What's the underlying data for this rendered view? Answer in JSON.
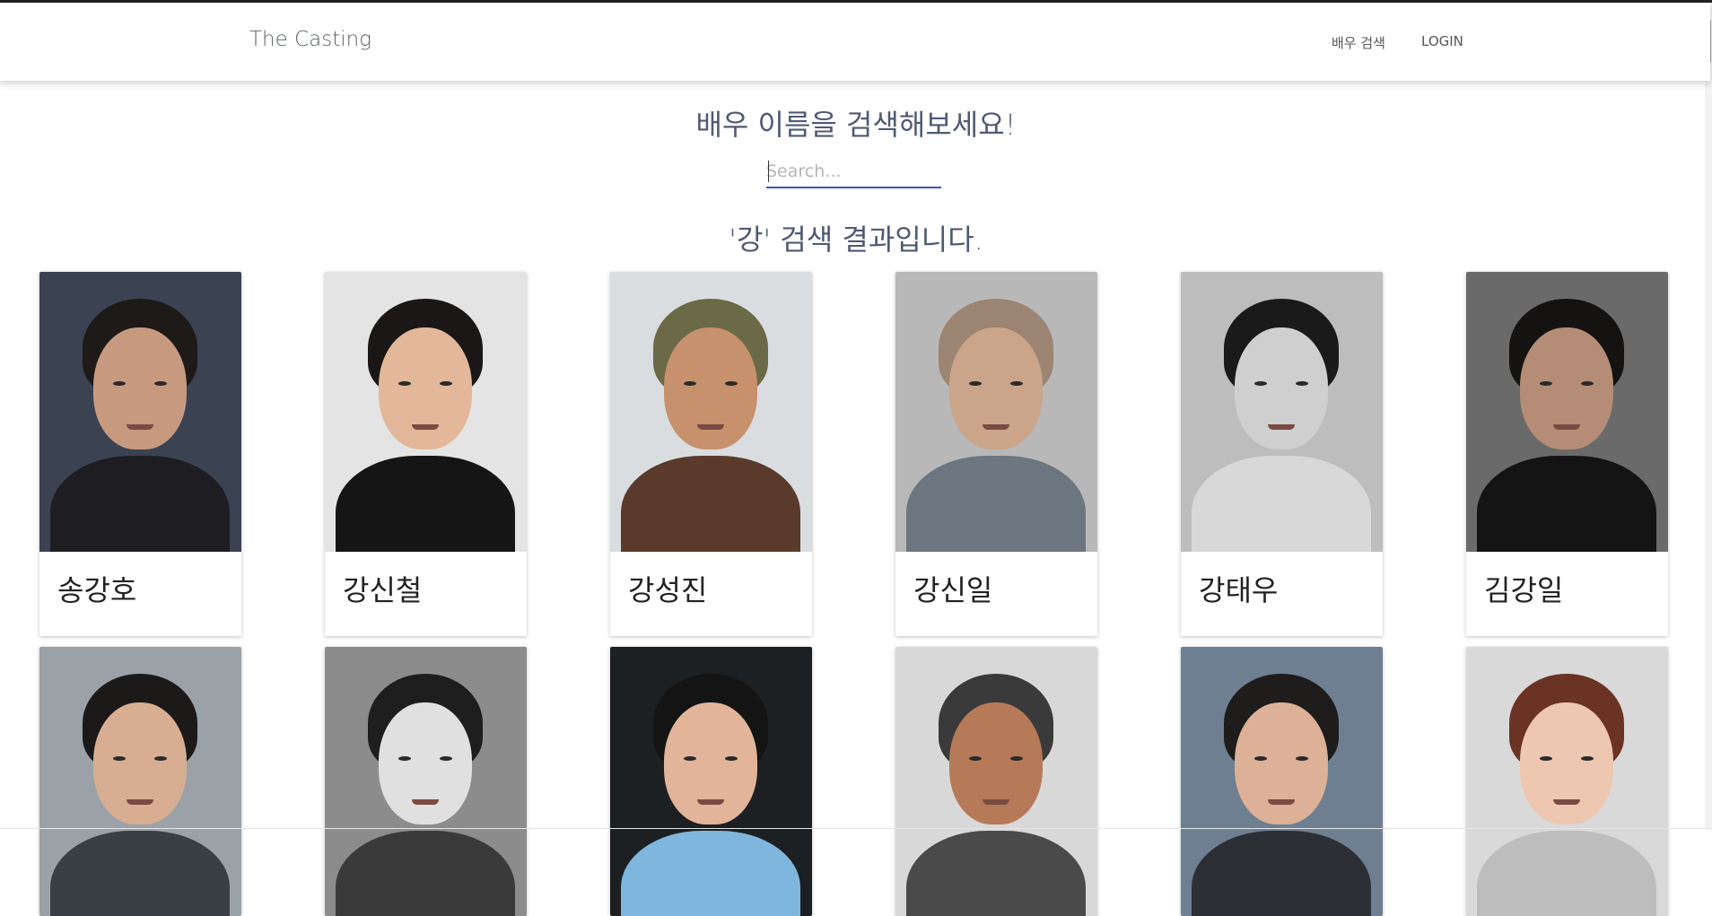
{
  "navbar": {
    "brand": "The Casting",
    "links": [
      {
        "label": "배우 검색"
      },
      {
        "label": "LOGIN"
      }
    ]
  },
  "search": {
    "heading": "배우 이름을 검색해보세요!",
    "placeholder": "Search...",
    "value": ""
  },
  "results": {
    "heading": "'강' 검색 결과입니다.",
    "actors": [
      {
        "name": "송강호",
        "photo_bg": "#3b4352",
        "skin": "#c79a80",
        "hair": "#1e1a18",
        "cloth": "#1e1e22"
      },
      {
        "name": "강신철",
        "photo_bg": "#e4e4e4",
        "skin": "#e3b799",
        "hair": "#1a1716",
        "cloth": "#151515"
      },
      {
        "name": "강성진",
        "photo_bg": "#d9dde0",
        "skin": "#c7916d",
        "hair": "#6b6a46",
        "cloth": "#5a3a2a"
      },
      {
        "name": "강신일",
        "photo_bg": "#b8b8b8",
        "skin": "#caa58a",
        "hair": "#9d8574",
        "cloth": "#6b7680"
      },
      {
        "name": "강태우",
        "photo_bg": "#bdbdbd",
        "skin": "#cfcfcf",
        "hair": "#1a1a1a",
        "cloth": "#d8d8d8"
      },
      {
        "name": "김강일",
        "photo_bg": "#6a6a6a",
        "skin": "#b58d76",
        "hair": "#151312",
        "cloth": "#141414"
      },
      {
        "name": "",
        "photo_bg": "#9aa2a8",
        "skin": "#d8ae92",
        "hair": "#1c1a19",
        "cloth": "#3a3f45"
      },
      {
        "name": "",
        "photo_bg": "#8c8c8c",
        "skin": "#e0e0e0",
        "hair": "#1e1e1e",
        "cloth": "#3a3a3a"
      },
      {
        "name": "",
        "photo_bg": "#1d2023",
        "skin": "#e2b59a",
        "hair": "#141414",
        "cloth": "#7fb6dd"
      },
      {
        "name": "",
        "photo_bg": "#d8d8d8",
        "skin": "#b77a58",
        "hair": "#3a3a3a",
        "cloth": "#4a4a4a"
      },
      {
        "name": "",
        "photo_bg": "#6f7f92",
        "skin": "#dcb197",
        "hair": "#1e1d1c",
        "cloth": "#2c2f34"
      },
      {
        "name": "",
        "photo_bg": "#d9d9d9",
        "skin": "#edc7b0",
        "hair": "#6b3324",
        "cloth": "#bdbdbd"
      }
    ]
  }
}
